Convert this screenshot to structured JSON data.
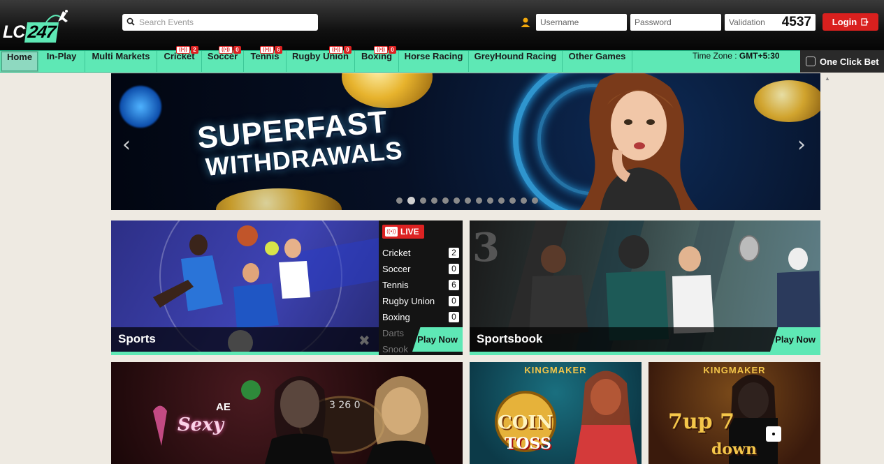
{
  "header": {
    "logo_text_main": "LC",
    "logo_text_num": "247",
    "search_placeholder": "Search Events",
    "username_placeholder": "Username",
    "password_placeholder": "Password",
    "validation_placeholder": "Validation",
    "validation_code": "4537",
    "login_label": "Login"
  },
  "nav": {
    "items": [
      {
        "label": "Home"
      },
      {
        "label": "In-Play"
      },
      {
        "label": "Multi Markets"
      },
      {
        "label": "Cricket",
        "count": "2"
      },
      {
        "label": "Soccer",
        "count": "0"
      },
      {
        "label": "Tennis",
        "count": "6"
      },
      {
        "label": "Rugby Union",
        "count": "0"
      },
      {
        "label": "Boxing",
        "count": "0"
      },
      {
        "label": "Horse Racing"
      },
      {
        "label": "GreyHound Racing"
      },
      {
        "label": "Other Games"
      }
    ],
    "timezone_label": "Time Zone :",
    "timezone_value": "GMT+5:30",
    "one_click_label": "One Click Bet"
  },
  "banner": {
    "title_line1": "SUPERFAST",
    "title_line2": "WITHDRAWALS",
    "prev_arrow": "‹",
    "next_arrow": "›",
    "dot_count": 13,
    "active_dot": 1
  },
  "sports_card": {
    "title": "Sports",
    "play_label": "Play Now",
    "live_label": "LIVE",
    "live_list": [
      {
        "name": "Cricket",
        "count": "2"
      },
      {
        "name": "Soccer",
        "count": "0"
      },
      {
        "name": "Tennis",
        "count": "6"
      },
      {
        "name": "Rugby Union",
        "count": "0"
      },
      {
        "name": "Boxing",
        "count": "0"
      },
      {
        "name": "Darts",
        "count": ""
      },
      {
        "name": "Snook",
        "count": ""
      }
    ]
  },
  "sportsbook_card": {
    "title": "Sportsbook",
    "play_label": "Play Now"
  },
  "games": {
    "sexy_brand": "AE",
    "sexy_title": "Sexy",
    "kingmaker_1": "KINGMAKER",
    "coin_line1": "COIN",
    "coin_line2": "TOSS",
    "kingmaker_2": "KINGMAKER",
    "updown_line1": "7up 7",
    "updown_line2": "down"
  },
  "colors": {
    "accent_green": "#5ee8b5",
    "login_red": "#d9201e",
    "badge_red": "#dd2222"
  }
}
